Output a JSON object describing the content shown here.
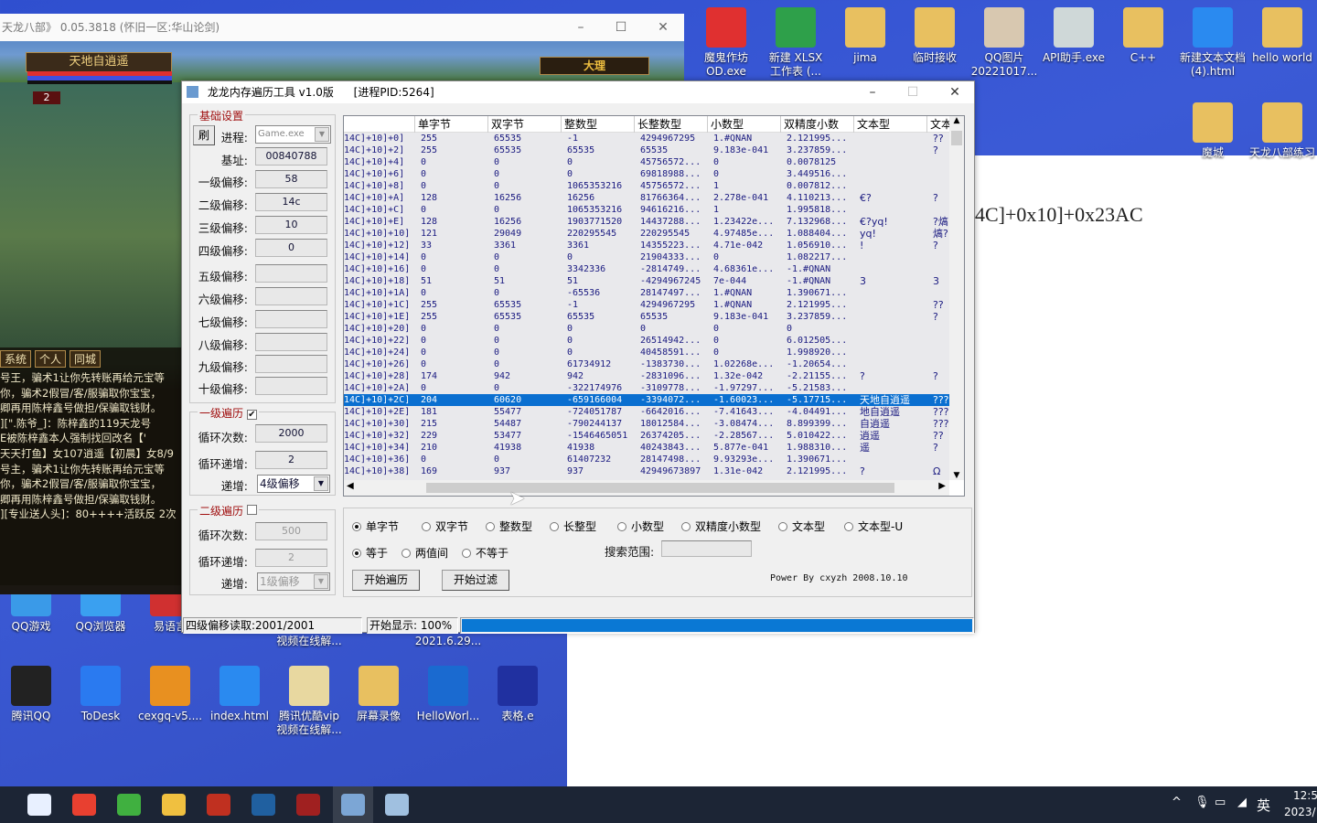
{
  "game": {
    "title": "天龙八部》 0.05.3818 (怀旧一区:华山论剑)",
    "player_name": "天地自逍遥",
    "level_badge": "2",
    "map_name": "大理",
    "chat_tabs": [
      "系统",
      "个人",
      "同城"
    ],
    "chat_lines": [
      "号王，骗术1让你先转账再给元宝等",
      "你，骗术2假冒/客/服骗取你宝宝，",
      "卿再用陈梓鑫号做担/保骗取钱财。",
      "][\".陈爷_]：陈梓鑫的119天龙号",
      "E被陈梓鑫本人强制找回改名【'",
      "天天打鱼】女107逍遥【初晨】女8/9",
      "号主，骗术1让你先转账再给元宝等",
      "你，骗术2假冒/客/服骗取你宝宝，",
      "卿再用陈梓鑫号做担/保骗取钱财。",
      "][专业送人头]：80++++活跃反 2次"
    ]
  },
  "desktop": {
    "icons_top": [
      {
        "label": "魔鬼作坊\nOD.exe",
        "color": "#e03030"
      },
      {
        "label": "新建 XLSX\n工作表 (...",
        "color": "#2ea04a"
      },
      {
        "label": "jima",
        "color": "#e8c060"
      },
      {
        "label": "临时接收",
        "color": "#e8c060"
      },
      {
        "label": "QQ图片\n20221017...",
        "color": "#d8c8b0"
      },
      {
        "label": "API助手.exe",
        "color": "#cfd8d8"
      },
      {
        "label": "C++",
        "color": "#e8c060"
      },
      {
        "label": "新建文本文档\n(4).html",
        "color": "#2a8af0"
      },
      {
        "label": "hello world",
        "color": "#e8c060"
      }
    ],
    "icons_right": [
      {
        "label": "魔城",
        "color": "#e8c060"
      },
      {
        "label": "天龙八部练习",
        "color": "#e8c060"
      }
    ],
    "icons_mid": [
      {
        "label": "QQ游戏",
        "color": "#3a9ae8"
      },
      {
        "label": "QQ浏览器",
        "color": "#3aa0f0"
      },
      {
        "label": "易语言",
        "color": "#d03030"
      }
    ],
    "partial_labels": [
      "视频在线解...",
      "2021.6.29..."
    ],
    "icons_bottom": [
      {
        "label": "腾讯QQ",
        "color": "#222"
      },
      {
        "label": "ToDesk",
        "color": "#2a7af0"
      },
      {
        "label": "cexgq-v5....",
        "color": "#e89020"
      },
      {
        "label": "index.html",
        "color": "#2a8af0"
      },
      {
        "label": "腾讯优酷vip\n视频在线解...",
        "color": "#e8d8a0"
      },
      {
        "label": "屏幕录像",
        "color": "#e8c060"
      },
      {
        "label": "HelloWorl...",
        "color": "#1a6ad0"
      },
      {
        "label": "表格.e",
        "color": "#2030a0"
      }
    ],
    "doc_text": "4C]+0x10]+0x23AC"
  },
  "taskbar": {
    "apps": [
      {
        "name": "start",
        "color": "#e8f0ff"
      },
      {
        "name": "chrome",
        "color": "#e84030"
      },
      {
        "name": "app-green",
        "color": "#40b040"
      },
      {
        "name": "file-explorer",
        "color": "#f0c040"
      },
      {
        "name": "game",
        "color": "#c03020"
      },
      {
        "name": "app-dark",
        "color": "#2060a0"
      },
      {
        "name": "app-red",
        "color": "#a02020"
      },
      {
        "name": "memory-tool",
        "color": "#6a9ad0"
      },
      {
        "name": "app-notepad",
        "color": "#a0c0e0"
      }
    ],
    "ime": "英",
    "time": "12:5",
    "date": "2023/"
  },
  "tool": {
    "title": "龙龙内存遍历工具 v1.0版",
    "pid": "[进程PID:5264]",
    "basic": {
      "group": "基础设置",
      "refresh": "刷",
      "process_label": "进程:",
      "process_value": "Game.exe",
      "base_label": "基址:",
      "base_value": "00840788",
      "offsets": [
        {
          "label": "一级偏移:",
          "value": "58"
        },
        {
          "label": "二级偏移:",
          "value": "14c"
        },
        {
          "label": "三级偏移:",
          "value": "10"
        },
        {
          "label": "四级偏移:",
          "value": "0"
        },
        {
          "label": "五级偏移:",
          "value": ""
        },
        {
          "label": "六级偏移:",
          "value": ""
        },
        {
          "label": "七级偏移:",
          "value": ""
        },
        {
          "label": "八级偏移:",
          "value": ""
        },
        {
          "label": "九级偏移:",
          "value": ""
        },
        {
          "label": "十级偏移:",
          "value": ""
        }
      ]
    },
    "loop1": {
      "group": "一级遍历",
      "checked": true,
      "count_label": "循环次数:",
      "count": "2000",
      "step_label": "循环递增:",
      "step": "2",
      "inc_label": "递增:",
      "inc": "4级偏移"
    },
    "loop2": {
      "group": "二级遍历",
      "checked": false,
      "count_label": "循环次数:",
      "count": "500",
      "step_label": "循环递增:",
      "step": "2",
      "inc_label": "递增:",
      "inc": "1级偏移"
    },
    "table": {
      "columns": [
        "",
        "单字节",
        "双字节",
        "整数型",
        "长整数型",
        "小数型",
        "双精度小数",
        "文本型",
        "文本"
      ],
      "selected_index": 22,
      "rows": [
        [
          "14C]+10]+0]",
          "255",
          "65535",
          "-1",
          "4294967295",
          "1.#QNAN",
          "2.121995...",
          "",
          "??"
        ],
        [
          "14C]+10]+2]",
          "255",
          "65535",
          "65535",
          "65535",
          "9.183e-041",
          "3.237859...",
          "",
          "?"
        ],
        [
          "14C]+10]+4]",
          "0",
          "0",
          "0",
          "45756572...",
          "0",
          "0.0078125",
          "",
          ""
        ],
        [
          "14C]+10]+6]",
          "0",
          "0",
          "0",
          "69818988...",
          "0",
          "3.449516...",
          "",
          ""
        ],
        [
          "14C]+10]+8]",
          "0",
          "0",
          "1065353216",
          "45756572...",
          "1",
          "0.007812...",
          "",
          ""
        ],
        [
          "14C]+10]+A]",
          "128",
          "16256",
          "16256",
          "81766364...",
          "2.278e-041",
          "4.110213...",
          "€?",
          "?"
        ],
        [
          "14C]+10]+C]",
          "0",
          "0",
          "1065353216",
          "94616216...",
          "1",
          "1.995818...",
          "",
          ""
        ],
        [
          "14C]+10]+E]",
          "128",
          "16256",
          "1903771520",
          "14437288...",
          "1.23422e...",
          "7.132968...",
          "€?yq!",
          "?熇"
        ],
        [
          "14C]+10]+10]",
          "121",
          "29049",
          "220295545",
          "220295545",
          "4.97485e...",
          "1.088404...",
          "yq!",
          "熇?"
        ],
        [
          "14C]+10]+12]",
          "33",
          "3361",
          "3361",
          "14355223...",
          "4.71e-042",
          "1.056910...",
          "!",
          "?"
        ],
        [
          "14C]+10]+14]",
          "0",
          "0",
          "0",
          "21904333...",
          "0",
          "1.082217...",
          "",
          ""
        ],
        [
          "14C]+10]+16]",
          "0",
          "0",
          "3342336",
          "-2814749...",
          "4.68361e...",
          "-1.#QNAN",
          "",
          ""
        ],
        [
          "14C]+10]+18]",
          "51",
          "51",
          "51",
          "-4294967245",
          "7e-044",
          "-1.#QNAN",
          "3",
          "3"
        ],
        [
          "14C]+10]+1A]",
          "0",
          "0",
          "-65536",
          "28147497...",
          "1.#QNAN",
          "1.390671...",
          "",
          ""
        ],
        [
          "14C]+10]+1C]",
          "255",
          "65535",
          "-1",
          "4294967295",
          "1.#QNAN",
          "2.121995...",
          "",
          "??"
        ],
        [
          "14C]+10]+1E]",
          "255",
          "65535",
          "65535",
          "65535",
          "9.183e-041",
          "3.237859...",
          "",
          "?"
        ],
        [
          "14C]+10]+20]",
          "0",
          "0",
          "0",
          "0",
          "0",
          "0",
          "",
          ""
        ],
        [
          "14C]+10]+22]",
          "0",
          "0",
          "0",
          "26514942...",
          "0",
          "6.012505...",
          "",
          ""
        ],
        [
          "14C]+10]+24]",
          "0",
          "0",
          "0",
          "40458591...",
          "0",
          "1.998920...",
          "",
          ""
        ],
        [
          "14C]+10]+26]",
          "0",
          "0",
          "61734912",
          "-1383730...",
          "1.02268e...",
          "-1.20654...",
          "",
          ""
        ],
        [
          "14C]+10]+28]",
          "174",
          "942",
          "942",
          "-2831096...",
          "1.32e-042",
          "-2.21155...",
          "?",
          "?"
        ],
        [
          "14C]+10]+2A]",
          "0",
          "0",
          "-322174976",
          "-3109778...",
          "-1.97297...",
          "-5.21583...",
          "",
          ""
        ],
        [
          "14C]+10]+2C]",
          "204",
          "60620",
          "-659166004",
          "-3394072...",
          "-1.60023...",
          "-5.17715...",
          "天地自逍遥",
          "???"
        ],
        [
          "14C]+10]+2E]",
          "181",
          "55477",
          "-724051787",
          "-6642016...",
          "-7.41643...",
          "-4.04491...",
          "地自逍遥",
          "???"
        ],
        [
          "14C]+10]+30]",
          "215",
          "54487",
          "-790244137",
          "18012584...",
          "-3.08474...",
          "8.899399...",
          "自逍遥",
          "???"
        ],
        [
          "14C]+10]+32]",
          "229",
          "53477",
          "-1546465051",
          "26374205...",
          "-2.28567...",
          "5.010422...",
          "逍遥",
          "??"
        ],
        [
          "14C]+10]+34]",
          "210",
          "41938",
          "41938",
          "40243843...",
          "5.877e-041",
          "1.988310...",
          "遥",
          "?"
        ],
        [
          "14C]+10]+36]",
          "0",
          "0",
          "61407232",
          "28147498...",
          "9.93293e...",
          "1.390671...",
          "",
          ""
        ],
        [
          "14C]+10]+38]",
          "169",
          "937",
          "937",
          "42949673897",
          "1.31e-042",
          "2.121995...",
          "?",
          "Ω"
        ]
      ]
    },
    "types": {
      "options": [
        "单字节",
        "双字节",
        "整数型",
        "长整型",
        "小数型",
        "双精度小数型",
        "文本型",
        "文本型-U"
      ],
      "selected": 0
    },
    "compare": {
      "options": [
        "等于",
        "两值间",
        "不等于"
      ],
      "selected": 0
    },
    "range_label": "搜索范围:",
    "range_value": "",
    "start_traverse": "开始遍历",
    "start_filter": "开始过滤",
    "credit": "Power By cxyzh 2008.10.10",
    "status": {
      "read": "四级偏移读取:2001/2001",
      "display": "开始显示: 100%",
      "progress": 100
    }
  }
}
